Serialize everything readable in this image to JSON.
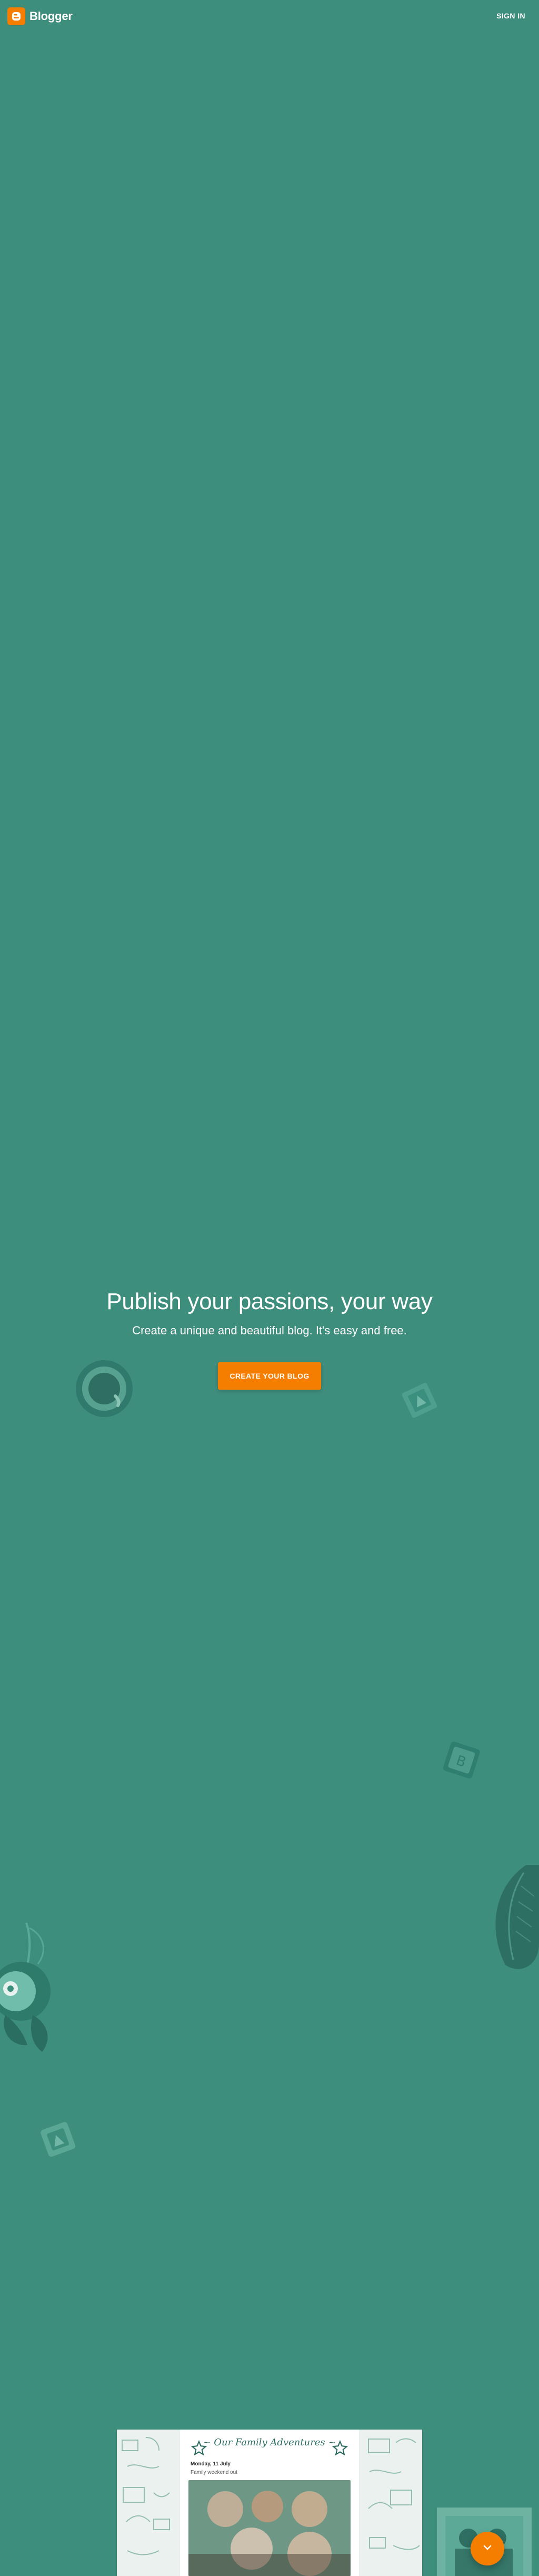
{
  "header": {
    "brand": "Blogger",
    "sign_in": "SIGN IN"
  },
  "hero": {
    "title": "Publish your passions, your way",
    "subtitle": "Create a unique and beautiful blog. It's easy and free.",
    "cta": "CREATE YOUR BLOG"
  },
  "preview": {
    "blog_title": "~ Our Family Adventures ~",
    "meta_1": "Monday, 11 July",
    "meta_2": "Family weekend out"
  },
  "colors": {
    "background": "#3e8e7e",
    "accent": "#f57d00",
    "text": "#ffffff"
  },
  "icons": {
    "logo": "blogger-logo-icon",
    "fab": "chevron-down-icon"
  }
}
